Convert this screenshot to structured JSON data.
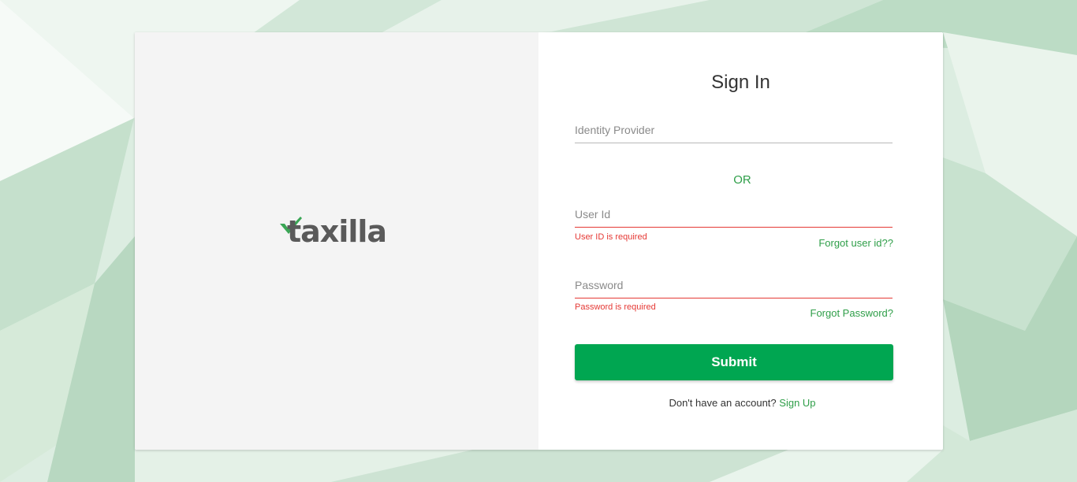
{
  "brand": {
    "logo_text": "taxilla",
    "logo_text_color": "#5a5a5a",
    "check_color": "#3aa655"
  },
  "signin": {
    "title": "Sign In",
    "identity_provider": {
      "placeholder": "Identity Provider",
      "value": ""
    },
    "or_label": "OR",
    "user_id": {
      "placeholder": "User Id",
      "value": "",
      "error": "User ID is required",
      "forgot_label": "Forgot user id??"
    },
    "password": {
      "placeholder": "Password",
      "value": "",
      "error": "Password is required",
      "forgot_label": "Forgot Password?"
    },
    "submit_label": "Submit",
    "signup_prompt": "Don't have an account?",
    "signup_link": "Sign Up"
  },
  "colors": {
    "accent": "#2e9e48",
    "button": "#00a651",
    "error": "#e53935",
    "background": "#dfeee3"
  }
}
